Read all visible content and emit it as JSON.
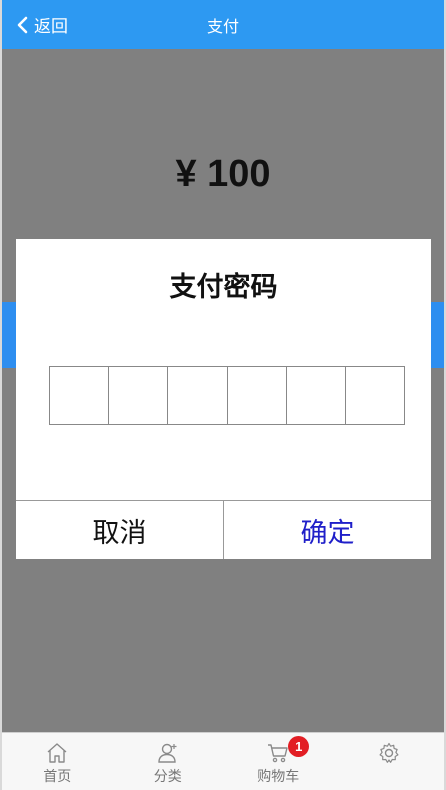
{
  "header": {
    "back_label": "返回",
    "title": "支付",
    "background": "#2d99f2"
  },
  "main": {
    "amount": "¥ 100"
  },
  "dialog": {
    "title": "支付密码",
    "pin_digits": [
      "",
      "",
      "",
      "",
      "",
      ""
    ],
    "cancel_label": "取消",
    "confirm_label": "确定",
    "confirm_color": "#1f1fc9"
  },
  "tabbar": {
    "items": [
      {
        "label": "首页",
        "icon": "home-icon"
      },
      {
        "label": "分类",
        "icon": "user-icon"
      },
      {
        "label": "购物车",
        "icon": "cart-icon",
        "badge": "1"
      },
      {
        "label": "",
        "icon": "gear-icon"
      }
    ],
    "badge_color": "#e21e24"
  }
}
